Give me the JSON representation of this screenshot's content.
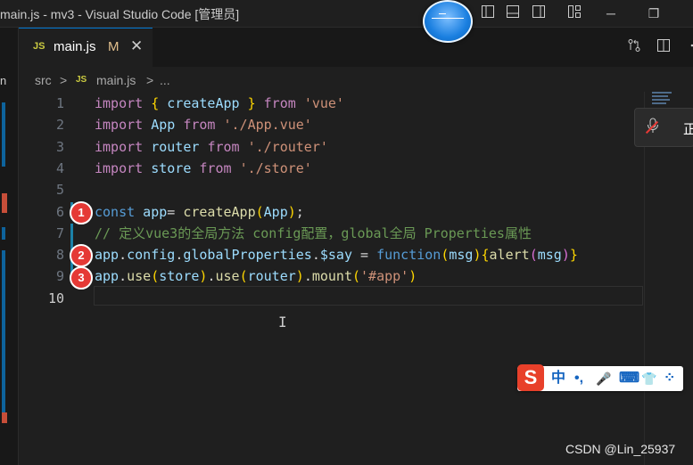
{
  "window": {
    "title": "main.js - mv3 - Visual Studio Code [管理员]"
  },
  "title_bar_icons": [
    "toggle-primary-sidebar-icon",
    "toggle-panel-icon",
    "toggle-secondary-sidebar-icon",
    "customize-layout-icon"
  ],
  "window_controls": {
    "minimize": "─",
    "restore": "❐"
  },
  "left_panel": {
    "text": "n"
  },
  "tab": {
    "icon": "JS",
    "name": "main.js",
    "modified": "M",
    "close": "✕"
  },
  "tab_actions": [
    "open-changes-icon",
    "split-editor-icon",
    "more-actions-icon"
  ],
  "breadcrumb": {
    "folder": "src",
    "sep1": ">",
    "icon": "JS",
    "file": "main.js",
    "sep2": ">",
    "rest": "..."
  },
  "editor": {
    "line_numbers": [
      "1",
      "2",
      "3",
      "4",
      "5",
      "6",
      "7",
      "8",
      "9",
      "10"
    ],
    "lines": [
      [
        {
          "t": "import",
          "c": "kw"
        },
        {
          "t": " ",
          "c": ""
        },
        {
          "t": "{",
          "c": "b1"
        },
        {
          "t": " createApp ",
          "c": "id"
        },
        {
          "t": "}",
          "c": "b1"
        },
        {
          "t": " ",
          "c": ""
        },
        {
          "t": "from",
          "c": "kw"
        },
        {
          "t": " ",
          "c": ""
        },
        {
          "t": "'vue'",
          "c": "str"
        }
      ],
      [
        {
          "t": "import",
          "c": "kw"
        },
        {
          "t": " App ",
          "c": "id"
        },
        {
          "t": "from",
          "c": "kw"
        },
        {
          "t": " ",
          "c": ""
        },
        {
          "t": "'./App.vue'",
          "c": "str"
        }
      ],
      [
        {
          "t": "import",
          "c": "kw"
        },
        {
          "t": " router ",
          "c": "id"
        },
        {
          "t": "from",
          "c": "kw"
        },
        {
          "t": " ",
          "c": ""
        },
        {
          "t": "'./router'",
          "c": "str"
        }
      ],
      [
        {
          "t": "import",
          "c": "kw"
        },
        {
          "t": " store ",
          "c": "id"
        },
        {
          "t": "from",
          "c": "kw"
        },
        {
          "t": " ",
          "c": ""
        },
        {
          "t": "'./store'",
          "c": "str"
        }
      ],
      [],
      [
        {
          "t": "const",
          "c": "stb"
        },
        {
          "t": " app",
          "c": "id"
        },
        {
          "t": "= ",
          "c": ""
        },
        {
          "t": "createApp",
          "c": "fn"
        },
        {
          "t": "(",
          "c": "b1"
        },
        {
          "t": "App",
          "c": "id"
        },
        {
          "t": ")",
          "c": "b1"
        },
        {
          "t": ";",
          "c": ""
        }
      ],
      [
        {
          "t": "// 定义vue3的全局方法 config配置，global全局 Properties属性",
          "c": "cm"
        }
      ],
      [
        {
          "t": "app",
          "c": "id"
        },
        {
          "t": ".",
          "c": ""
        },
        {
          "t": "config",
          "c": "id"
        },
        {
          "t": ".",
          "c": ""
        },
        {
          "t": "globalProperties",
          "c": "id"
        },
        {
          "t": ".",
          "c": ""
        },
        {
          "t": "$say",
          "c": "id"
        },
        {
          "t": " = ",
          "c": ""
        },
        {
          "t": "function",
          "c": "stb"
        },
        {
          "t": "(",
          "c": "b1"
        },
        {
          "t": "msg",
          "c": "id"
        },
        {
          "t": ")",
          "c": "b1"
        },
        {
          "t": "{",
          "c": "b1"
        },
        {
          "t": "alert",
          "c": "fn"
        },
        {
          "t": "(",
          "c": "b2"
        },
        {
          "t": "msg",
          "c": "id"
        },
        {
          "t": ")",
          "c": "b2"
        },
        {
          "t": "}",
          "c": "b1"
        }
      ],
      [
        {
          "t": "app",
          "c": "id"
        },
        {
          "t": ".",
          "c": ""
        },
        {
          "t": "use",
          "c": "fn"
        },
        {
          "t": "(",
          "c": "b1"
        },
        {
          "t": "store",
          "c": "id"
        },
        {
          "t": ")",
          "c": "b1"
        },
        {
          "t": ".",
          "c": ""
        },
        {
          "t": "use",
          "c": "fn"
        },
        {
          "t": "(",
          "c": "b1"
        },
        {
          "t": "router",
          "c": "id"
        },
        {
          "t": ")",
          "c": "b1"
        },
        {
          "t": ".",
          "c": ""
        },
        {
          "t": "mount",
          "c": "fn"
        },
        {
          "t": "(",
          "c": "b1"
        },
        {
          "t": "'#app'",
          "c": "str"
        },
        {
          "t": ")",
          "c": "b1"
        }
      ],
      []
    ],
    "active_line": 10
  },
  "annotations": [
    "1",
    "2",
    "3"
  ],
  "mic_popup": {
    "text": "正"
  },
  "ime_toolbar": {
    "logo": "S",
    "items": [
      "中",
      "•,",
      "🎤",
      "⌨",
      "👕",
      "⁘"
    ]
  },
  "watermark": "CSDN @Lin_25937"
}
